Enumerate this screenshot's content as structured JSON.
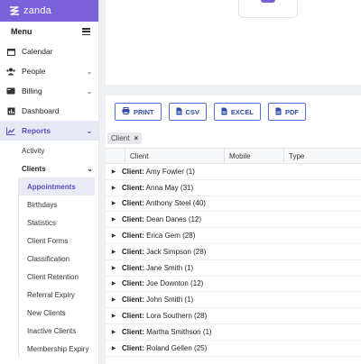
{
  "brand": {
    "name": "zanda"
  },
  "menu": {
    "title": "Menu"
  },
  "nav": {
    "calendar": "Calendar",
    "people": "People",
    "billing": "Billing",
    "dashboard": "Dashboard",
    "reports": "Reports"
  },
  "reports_sub": {
    "activity": "Activity",
    "clients": "Clients"
  },
  "clients_sub": [
    "Appointments",
    "Birthdays",
    "Statistics",
    "Client Forms",
    "Classification",
    "Client Retention",
    "Referral Expiry",
    "New Clients",
    "Inactive Clients",
    "Membership Expiry"
  ],
  "toolbar": {
    "print": "PRINT",
    "csv": "CSV",
    "excel": "EXCEL",
    "pdf": "PDF"
  },
  "group_chip": {
    "label": "Client",
    "close": "×"
  },
  "table": {
    "columns": [
      "Client",
      "Mobile",
      "Type"
    ],
    "group_prefix": "Client:",
    "rows": [
      "Amy Fowler (1)",
      "Anna May (31)",
      "Anthony Steel (40)",
      "Dean Danes (12)",
      "Erica Gem (28)",
      "Jack Simpson (28)",
      "Jane Smith (1)",
      "Joe Downton (12)",
      "John Smith (1)",
      "Lora Southern (28)",
      "Martha Smithson (1)",
      "Roland Gellen (25)"
    ]
  },
  "colors": {
    "brand": "#7b61d9",
    "accent": "#5b4bc4",
    "button": "#2d4aa6"
  }
}
